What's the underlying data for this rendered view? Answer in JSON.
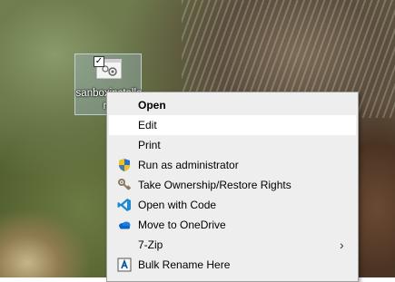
{
  "desktop_icon": {
    "label": "sanboxinstaller.b",
    "checked": true
  },
  "menu": {
    "items": [
      {
        "label": "Open",
        "icon": null,
        "bold": true
      },
      {
        "label": "Edit",
        "icon": null,
        "highlighted": true
      },
      {
        "label": "Print",
        "icon": null
      },
      {
        "label": "Run as administrator",
        "icon": "uac-shield-icon"
      },
      {
        "label": "Take Ownership/Restore Rights",
        "icon": "keys-icon"
      },
      {
        "label": "Open with Code",
        "icon": "vscode-icon"
      },
      {
        "label": "Move to OneDrive",
        "icon": "onedrive-icon"
      },
      {
        "label": "7-Zip",
        "icon": null,
        "submenu": true
      },
      {
        "label": "Bulk Rename Here",
        "icon": "bulk-rename-icon"
      }
    ]
  },
  "colors": {
    "menu_bg": "#eeeeee",
    "highlight_bg": "#ffffff",
    "onedrive": "#0a64c8",
    "vscode": "#1f8ad2"
  }
}
